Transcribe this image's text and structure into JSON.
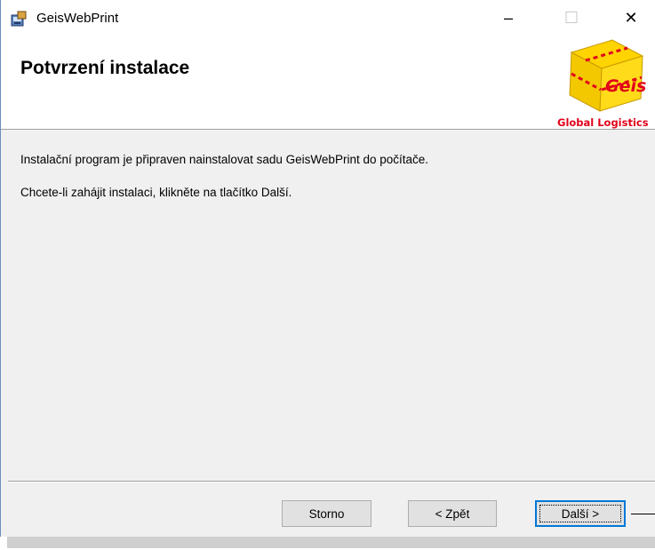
{
  "window": {
    "title": "GeisWebPrint",
    "controls": {
      "minimize": "–",
      "maximize": "☐",
      "close": "✕"
    }
  },
  "header": {
    "page_title": "Potvrzení instalace",
    "logo": {
      "text": "Geis",
      "tagline": "Global Logistics"
    }
  },
  "content": {
    "line1": "Instalační program je připraven nainstalovat sadu GeisWebPrint do počítače.",
    "line2": "Chcete-li zahájit instalaci, klikněte na tlačítko Další."
  },
  "buttons": {
    "cancel": "Storno",
    "back": "< Zpět",
    "next": "Další >"
  },
  "colors": {
    "accent": "#0078d7",
    "logo_yellow": "#f3c800",
    "logo_red": "#e2001a"
  }
}
